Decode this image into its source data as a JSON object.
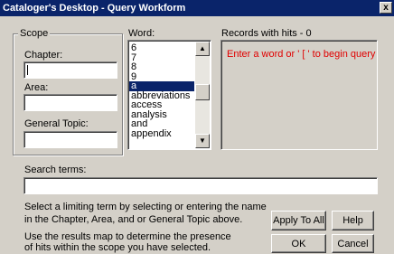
{
  "window": {
    "title": "Cataloger's Desktop - Query Workform",
    "close_label": "x"
  },
  "scope": {
    "legend": "Scope",
    "chapter_label": "Chapter:",
    "chapter_value": "",
    "area_label": "Area:",
    "area_value": "",
    "topic_label": "General Topic:",
    "topic_value": ""
  },
  "word": {
    "label": "Word:",
    "items": [
      "6",
      "7",
      "8",
      "9",
      "a",
      "abbreviations",
      "access",
      "analysis",
      "and",
      "appendix"
    ],
    "selected": "a"
  },
  "records": {
    "label": "Records with hits - 0",
    "message": "Enter a word or ' [ ' to begin query",
    "message_color": "#e00000"
  },
  "search": {
    "label": "Search terms:",
    "value": ""
  },
  "help": {
    "line1": "Select a limiting term by selecting or entering the name",
    "line2": "in the Chapter, Area, and or General Topic above.",
    "line3": "Use the results map to determine the presence",
    "line4": "of hits within the scope you have selected."
  },
  "buttons": {
    "apply_all": "Apply To All",
    "help": "Help",
    "ok": "OK",
    "cancel": "Cancel"
  }
}
